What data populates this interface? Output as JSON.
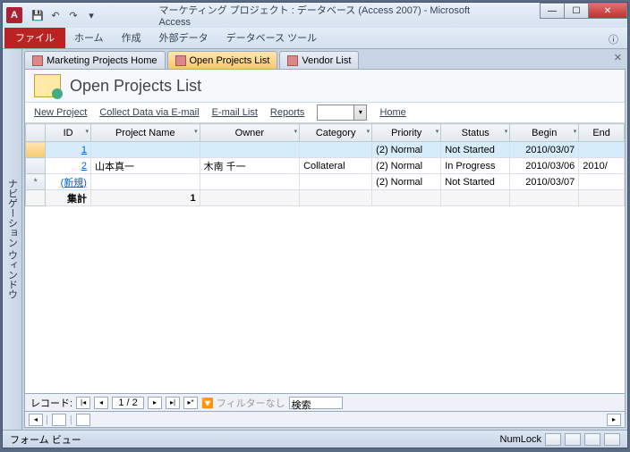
{
  "title": "マーケティング プロジェクト : データベース (Access 2007) - Microsoft Access",
  "ribbon": {
    "file": "ファイル",
    "home": "ホーム",
    "create": "作成",
    "external": "外部データ",
    "dbtools": "データベース ツール"
  },
  "navpane": "ナビゲーション ウィンドウ",
  "tabs": [
    {
      "label": "Marketing Projects Home"
    },
    {
      "label": "Open Projects List"
    },
    {
      "label": "Vendor List"
    }
  ],
  "form": {
    "title": "Open Projects List"
  },
  "toolbar": {
    "new": "New Project",
    "collect": "Collect Data via E-mail",
    "email": "E-mail List",
    "reports": "Reports",
    "home": "Home"
  },
  "cols": {
    "id": "ID",
    "name": "Project Name",
    "owner": "Owner",
    "category": "Category",
    "priority": "Priority",
    "status": "Status",
    "begin": "Begin",
    "end": "End"
  },
  "rows": [
    {
      "id": "1",
      "name": "",
      "owner": "",
      "category": "",
      "priority": "(2) Normal",
      "status": "Not Started",
      "begin": "2010/03/07",
      "end": ""
    },
    {
      "id": "2",
      "name": "山本真一",
      "owner": "木南 千一",
      "category": "Collateral",
      "priority": "(2) Normal",
      "status": "In Progress",
      "begin": "2010/03/06",
      "end": "2010/"
    },
    {
      "id": "(新規)",
      "name": "",
      "owner": "",
      "category": "",
      "priority": "(2) Normal",
      "status": "Not Started",
      "begin": "2010/03/07",
      "end": ""
    }
  ],
  "sum": {
    "label": "集計",
    "count": "1"
  },
  "recnav": {
    "label": "レコード:",
    "pos": "1 / 2",
    "filter": "フィルターなし",
    "search": "検索"
  },
  "status": {
    "view": "フォーム ビュー",
    "numlock": "NumLock"
  }
}
